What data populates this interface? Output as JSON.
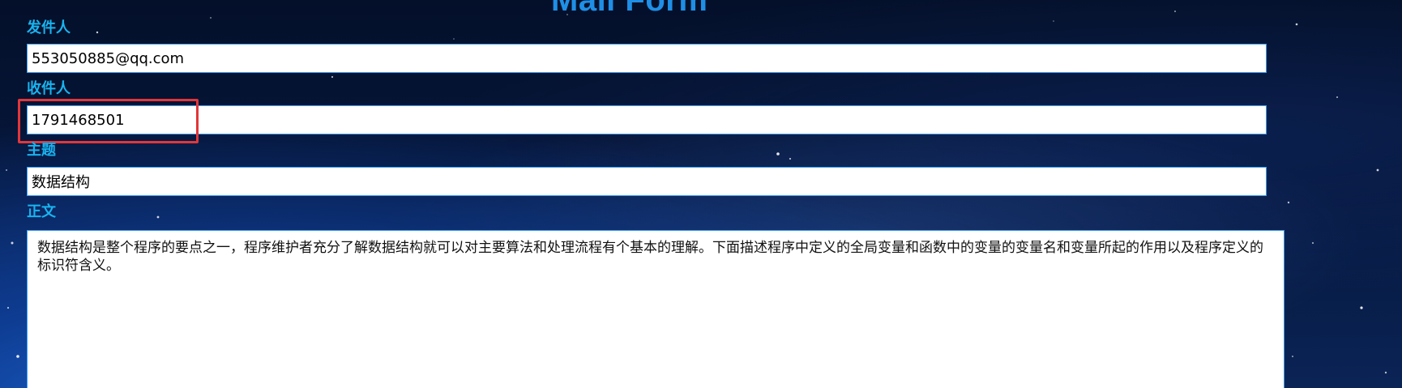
{
  "form": {
    "title": "Mail Form",
    "sender": {
      "label": "发件人",
      "value": "553050885@qq.com"
    },
    "recipient": {
      "label": "收件人",
      "value": "1791468501"
    },
    "subject": {
      "label": "主题",
      "value": "数据结构"
    },
    "body": {
      "label": "正文",
      "value": "数据结构是整个程序的要点之一，程序维护者充分了解数据结构就可以对主要算法和处理流程有个基本的理解。下面描述程序中定义的全局变量和函数中的变量的变量名和变量所起的作用以及程序定义的标识符含义。"
    }
  },
  "colors": {
    "label": "#18b4f0",
    "title": "#1f8fe6",
    "input_border": "#3a9ef0",
    "highlight": "#e2363a"
  }
}
